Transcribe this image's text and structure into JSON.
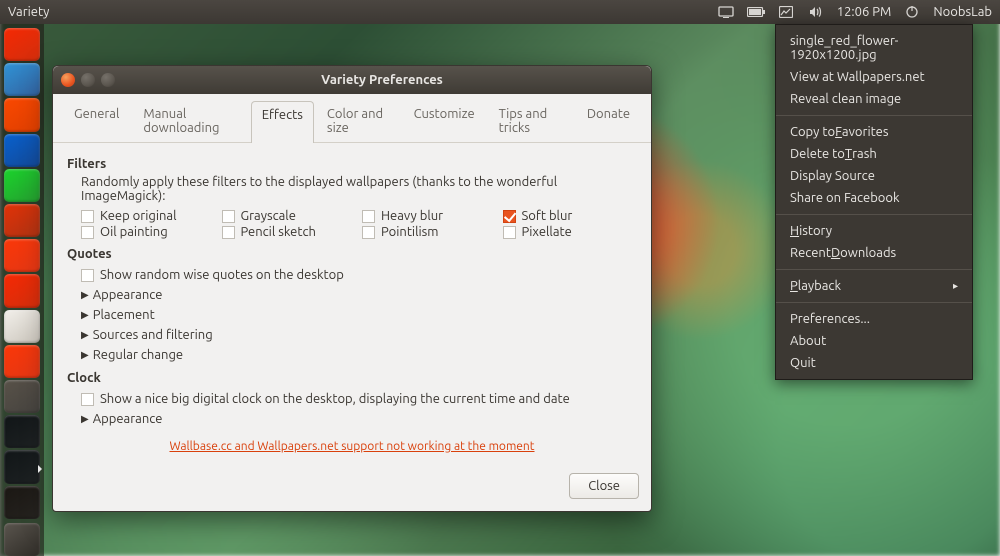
{
  "menubar": {
    "app_title": "Variety",
    "clock": "12:06 PM",
    "user": "NoobsLab"
  },
  "launcher": {
    "items": [
      {
        "name": "dash",
        "color": "#dd4814"
      },
      {
        "name": "files",
        "color": "#4e8ab7"
      },
      {
        "name": "firefox",
        "color": "#e66000"
      },
      {
        "name": "libreoffice-writer",
        "color": "#1f6fb0"
      },
      {
        "name": "libreoffice-calc",
        "color": "#3ab54a"
      },
      {
        "name": "libreoffice-impress",
        "color": "#c24f1e"
      },
      {
        "name": "software-center",
        "color": "#e95420"
      },
      {
        "name": "ubuntu-one",
        "color": "#dd4814"
      },
      {
        "name": "amazon",
        "color": "#d7d3cc"
      },
      {
        "name": "update",
        "color": "#e95420"
      },
      {
        "name": "settings",
        "color": "#6a6660"
      },
      {
        "name": "terminal",
        "color": "#2e3436"
      },
      {
        "name": "variety",
        "color": "#2e3436",
        "active": true
      },
      {
        "name": "workspace",
        "color": "#3a3631"
      }
    ],
    "trash": {
      "name": "trash",
      "color": "#3a3631"
    }
  },
  "popup": {
    "groups": [
      [
        {
          "label": "single_red_flower-1920x1200.jpg",
          "u": ""
        },
        {
          "label": "View at Wallpapers.net",
          "u": ""
        },
        {
          "label": "Reveal clean image",
          "u": ""
        }
      ],
      [
        {
          "label": "Copy to Favorites",
          "u": "F"
        },
        {
          "label": "Delete to Trash",
          "u": "T"
        },
        {
          "label": "Display Source",
          "u": ""
        },
        {
          "label": "Share on Facebook",
          "u": ""
        }
      ],
      [
        {
          "label": "History",
          "u": "H"
        },
        {
          "label": "Recent Downloads",
          "u": "D"
        }
      ],
      [
        {
          "label": "Playback",
          "u": "P",
          "submenu": true
        }
      ],
      [
        {
          "label": "Preferences...",
          "u": ""
        },
        {
          "label": "About",
          "u": ""
        },
        {
          "label": "Quit",
          "u": ""
        }
      ]
    ]
  },
  "window": {
    "title": "Variety Preferences",
    "tabs": [
      "General",
      "Manual downloading",
      "Effects",
      "Color and size",
      "Customize",
      "Tips and tricks",
      "Donate"
    ],
    "active_tab": 2,
    "filters_title": "Filters",
    "filters_hint": "Randomly apply these filters to the displayed wallpapers (thanks to the wonderful ImageMagick):",
    "filters": [
      {
        "label": "Keep original",
        "checked": false
      },
      {
        "label": "Grayscale",
        "checked": false
      },
      {
        "label": "Heavy blur",
        "checked": false
      },
      {
        "label": "Soft blur",
        "checked": true
      },
      {
        "label": "Oil painting",
        "checked": false
      },
      {
        "label": "Pencil sketch",
        "checked": false
      },
      {
        "label": "Pointilism",
        "checked": false
      },
      {
        "label": "Pixellate",
        "checked": false
      }
    ],
    "quotes_title": "Quotes",
    "quotes_check": "Show random wise quotes on the desktop",
    "quotes_expanders": [
      "Appearance",
      "Placement",
      "Sources and filtering",
      "Regular change"
    ],
    "clock_title": "Clock",
    "clock_check": "Show a nice big digital clock on the desktop, displaying the current time and date",
    "clock_expanders": [
      "Appearance"
    ],
    "warn": "Wallbase.cc and Wallpapers.net support not working at the moment",
    "close": "Close"
  }
}
